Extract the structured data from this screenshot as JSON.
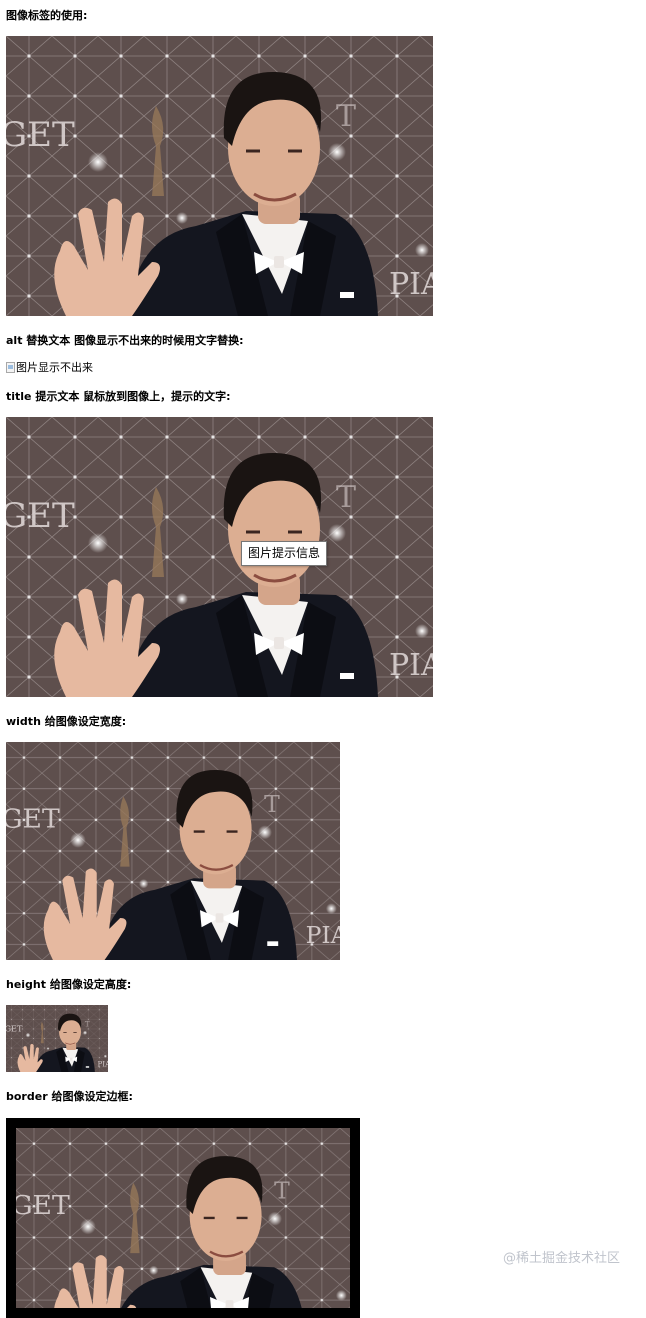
{
  "sections": {
    "intro": "图像标签的使用:",
    "alt": "alt 替换文本 图像显示不出来的时候用文字替换:",
    "alt_text": "图片显示不出来",
    "title": "title 提示文本 鼠标放到图像上，提示的文字:",
    "tooltip": "图片提示信息",
    "width": "width 给图像设定宽度:",
    "height": "height 给图像设定高度:",
    "border": "border 给图像设定边框:"
  },
  "watermark": "@稀土掘金技术社区",
  "colors": {
    "backdrop": "#5e4f4d",
    "suit": "#14161f",
    "shirt": "#f4f2f0",
    "border": "#000000"
  }
}
